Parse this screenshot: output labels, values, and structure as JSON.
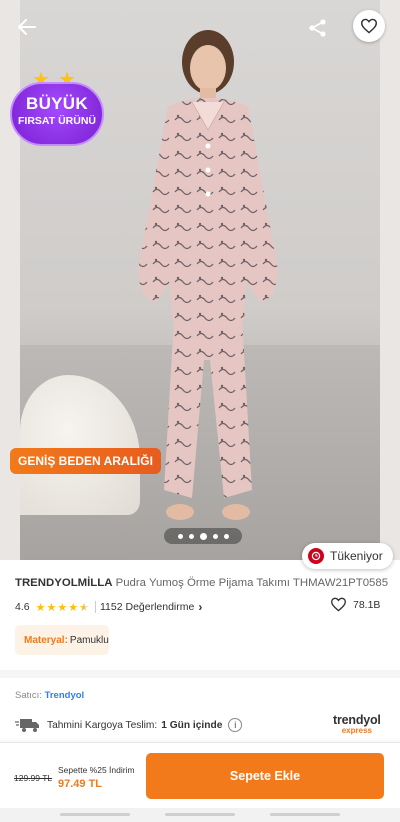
{
  "icons": {
    "back": "arrow-left-icon",
    "share": "share-icon",
    "favorite": "heart-icon",
    "clock": "clock-icon",
    "truck": "truck-icon",
    "info": "info-icon"
  },
  "gallery": {
    "badge_line1": "BÜYÜK",
    "badge_line2": "FIRSAT ÜRÜNÜ",
    "size_badge": "GENİŞ BEDEN ARALIĞI",
    "dot_count": 5,
    "active_dot": 3,
    "stock_label": "Tükeniyor"
  },
  "product": {
    "brand": "TRENDYOLMİLLA",
    "name": "Pudra Yumoş Örme Pijama Takımı THMAW21PT0585",
    "rating": "4.6",
    "stars_filled": 4.5,
    "reviews": "1152 Değerlendirme",
    "favorites": "78.1B",
    "material_key": "Materyal:",
    "material_value": "Pamuklu"
  },
  "seller": {
    "label": "Satıcı:",
    "name": "Trendyol"
  },
  "shipping": {
    "label": "Tahmini Kargoya Teslim:",
    "value": "1 Gün içinde",
    "info": "i",
    "logo_top": "trendyol",
    "logo_bottom": "express"
  },
  "purchase": {
    "old_price": "129.99 TL",
    "promo": "Sepette %25 İndirim",
    "new_price": "97.49 TL",
    "add_button": "Sepete Ekle"
  },
  "colors": {
    "accent": "#f27a1a",
    "badge_purple": "#8a2be2",
    "stock_red": "#d0021b",
    "link_blue": "#2f80ed"
  }
}
